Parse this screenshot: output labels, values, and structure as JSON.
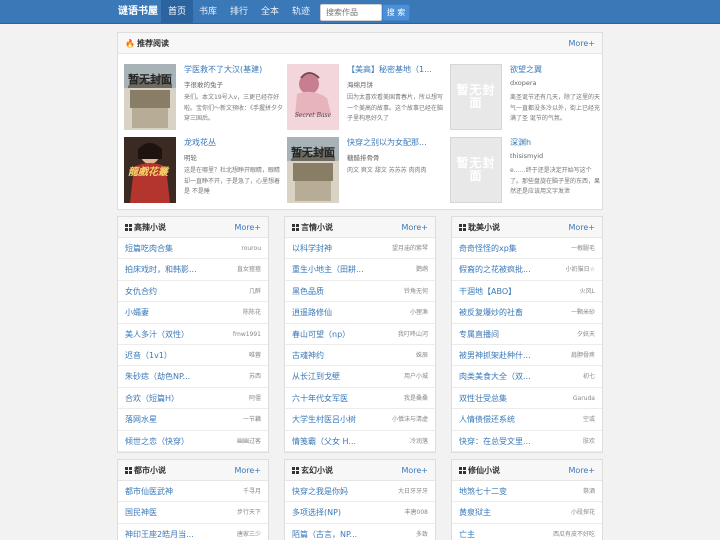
{
  "nav": {
    "brand": "谜语书屋",
    "items": [
      "首页",
      "书库",
      "排行",
      "全本",
      "轨迹"
    ],
    "search_placeholder": "搜索作品",
    "search_button": "搜 索"
  },
  "recommend": {
    "title": "推荐阅读",
    "more": "More+",
    "items": [
      {
        "title": "学医救不了大汉(基建)",
        "author": "字很敢的兔子",
        "desc": "来们。本文19号入v，三更已经存好啦。宝你们～新文预收：《手握拼夕夕穿三国后。",
        "cover_text": "暂无封面"
      },
      {
        "title": "【美高】秘密基地（1...",
        "author": "海绵月饼",
        "desc": "因为太喜欢看美国青春片，所以想写一个美高的故事。这个故事已经在脑子里构思好久了",
        "cover_text": "Secret Base"
      },
      {
        "title": "欲望之翼",
        "author": "dxopera",
        "desc": "离圣诞节还有几天，除了这里的天气一直都没多冷以外，街上已经充满了圣 诞节的气氛。",
        "cover_text": "暂无封面"
      },
      {
        "title": "龙戏花丛",
        "author": "明轮",
        "desc": "这是在哪里？杜北想睁开眼睛，眼睛却一直睁不开，于是急了，心里想着是 不是睡",
        "cover_text": "龍戲花叢"
      },
      {
        "title": "快穿之别以为女配那...",
        "author": "糖醋排骨骨",
        "desc": "肉文 爽文 甜文 苏苏苏 肉肉肉",
        "cover_text": "暂无封面"
      },
      {
        "title": "深渊h",
        "author": "thisismyid",
        "desc": "e……终于还是决定开始写这个了。那些盘旋在脑子里的东西，果然还是应该用文字发泄",
        "cover_text": "暂无封面"
      }
    ]
  },
  "sections": [
    {
      "title": "高辣小说",
      "more": "More+",
      "rows": [
        {
          "title": "短篇吃肉合集",
          "author": "rourou"
        },
        {
          "title": "拍床戏时，和韩影...",
          "author": "直女猹猹"
        },
        {
          "title": "女仇合约",
          "author": "几醉"
        },
        {
          "title": "小孀妻",
          "author": "陈陈花"
        },
        {
          "title": "美人多汁（双性）",
          "author": "fmw1991"
        },
        {
          "title": "迟音（1v1）",
          "author": "唯蓉"
        },
        {
          "title": "朱砂痣（劫色NP...",
          "author": "苏西"
        },
        {
          "title": "合欢（短篇H）",
          "author": "阿僵"
        },
        {
          "title": "落网水星",
          "author": "一节藕"
        },
        {
          "title": "倾世之恋（快穿）",
          "author": "幽幽过客"
        }
      ]
    },
    {
      "title": "言情小说",
      "more": "More+",
      "rows": [
        {
          "title": "以科学封神",
          "author": "望月庙的紫琴"
        },
        {
          "title": "重生小地主（田耕...",
          "author": "鹦鹉"
        },
        {
          "title": "黑色品质",
          "author": "铃角无何"
        },
        {
          "title": "逍遥路修仙",
          "author": "小狸渔"
        },
        {
          "title": "春山可望（np）",
          "author": "我叮咚山河"
        },
        {
          "title": "古魂神约",
          "author": "姝辰"
        },
        {
          "title": "从长江到戈壁",
          "author": "用户小城"
        },
        {
          "title": "六十年代女军医",
          "author": "我是桑桑"
        },
        {
          "title": "大学生村医吕小树",
          "author": "小慎沫与清虚"
        },
        {
          "title": "情笺霸（父女 H...",
          "author": "冷润落"
        }
      ]
    },
    {
      "title": "耽美小说",
      "more": "More+",
      "rows": [
        {
          "title": "奇奇怪怪的xp集",
          "author": "一根腿毛"
        },
        {
          "title": "假裔的之花被疯批...",
          "author": "小奶猫日☆"
        },
        {
          "title": "干涸地【ABO】",
          "author": "火风L"
        },
        {
          "title": "被反复爆炒的社畜",
          "author": "一颗米砂"
        },
        {
          "title": "专属直播间",
          "author": "夕妖天"
        },
        {
          "title": "被男神抓架赴种什...",
          "author": "肩胛骨疼"
        },
        {
          "title": "肉类美食大全（双...",
          "author": "初七"
        },
        {
          "title": "双性壮受总集",
          "author": "Garuda"
        },
        {
          "title": "人情债偿还系统",
          "author": "空或"
        },
        {
          "title": "快穿：在总受文里...",
          "author": "肤欢"
        }
      ]
    },
    {
      "title": "都市小说",
      "more": "More+",
      "rows": [
        {
          "title": "都市仙医武神",
          "author": "千寻月"
        },
        {
          "title": "国民神医",
          "author": "步行天下"
        },
        {
          "title": "神印王座2皓月当...",
          "author": "唐家三少"
        }
      ]
    },
    {
      "title": "玄幻小说",
      "more": "More+",
      "rows": [
        {
          "title": "快穿之我是你妈",
          "author": "大日牙牙牙"
        },
        {
          "title": "多项选择(NP)",
          "author": "丰唐008"
        },
        {
          "title": "陌篇（古言，NP...",
          "author": "多致"
        }
      ]
    },
    {
      "title": "修仙小说",
      "more": "More+",
      "rows": [
        {
          "title": "地煞七十二变",
          "author": "祭酒"
        },
        {
          "title": "黄泉狱主",
          "author": "小段探花"
        },
        {
          "title": "亡主",
          "author": "西瓜有皮不好吃"
        }
      ]
    }
  ]
}
